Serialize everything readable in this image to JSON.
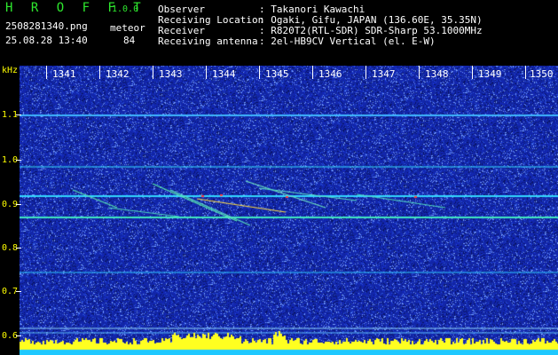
{
  "app": {
    "name": "H R O F F T",
    "version": "1.0.0"
  },
  "file": {
    "name": "2508281340.png",
    "datetime": "25.08.28 13:40"
  },
  "meteor": {
    "label": "meteor",
    "count": "84"
  },
  "info": [
    {
      "label": "Observer",
      "value": ": Takanori Kawachi"
    },
    {
      "label": "Receiving Location",
      "value": ": Ogaki, Gifu, JAPAN (136.60E, 35.35N)"
    },
    {
      "label": "Receiver",
      "value": ": R820T2(RTL-SDR) SDR-Sharp 53.1000MHz"
    },
    {
      "label": "Receiving antenna",
      "value": ": 2el-HB9CV Vertical (el. E-W)"
    }
  ],
  "axis": {
    "y_unit": "kHz",
    "y_ticks": [
      "1.1",
      "1.0",
      "0.9",
      "0.8",
      "0.7",
      "0.6"
    ],
    "x_ticks": [
      "1341",
      "1342",
      "1343",
      "1344",
      "1345",
      "1346",
      "1347",
      "1348",
      "1349",
      "1350"
    ]
  },
  "colors": {
    "background": "#1a2fb0",
    "accent": "#2ee82e",
    "label": "#ffff00"
  }
}
